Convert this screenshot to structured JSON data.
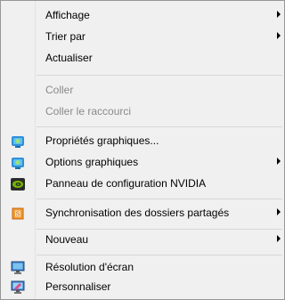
{
  "menu": {
    "items": [
      {
        "label": "Affichage",
        "submenu": true,
        "disabled": false,
        "icon": null
      },
      {
        "label": "Trier par",
        "submenu": true,
        "disabled": false,
        "icon": null
      },
      {
        "label": "Actualiser",
        "submenu": false,
        "disabled": false,
        "icon": null
      },
      {
        "label": "Coller",
        "submenu": false,
        "disabled": true,
        "icon": null
      },
      {
        "label": "Coller le raccourci",
        "submenu": false,
        "disabled": true,
        "icon": null
      },
      {
        "label": "Propriétés graphiques...",
        "submenu": false,
        "disabled": false,
        "icon": "intel-graphics-icon"
      },
      {
        "label": "Options graphiques",
        "submenu": true,
        "disabled": false,
        "icon": "intel-graphics-icon"
      },
      {
        "label": "Panneau de configuration NVIDIA",
        "submenu": false,
        "disabled": false,
        "icon": "nvidia-icon"
      },
      {
        "label": "Synchronisation des dossiers partagés",
        "submenu": true,
        "disabled": false,
        "icon": "sync-folder-icon"
      },
      {
        "label": "Nouveau",
        "submenu": true,
        "disabled": false,
        "icon": null
      },
      {
        "label": "Résolution d'écran",
        "submenu": false,
        "disabled": false,
        "icon": "display-resolution-icon"
      },
      {
        "label": "Personnaliser",
        "submenu": false,
        "disabled": false,
        "icon": "personalize-icon"
      }
    ]
  },
  "colors": {
    "menu_background": "#f0f0f0",
    "disabled_text": "#8a8a8a"
  }
}
